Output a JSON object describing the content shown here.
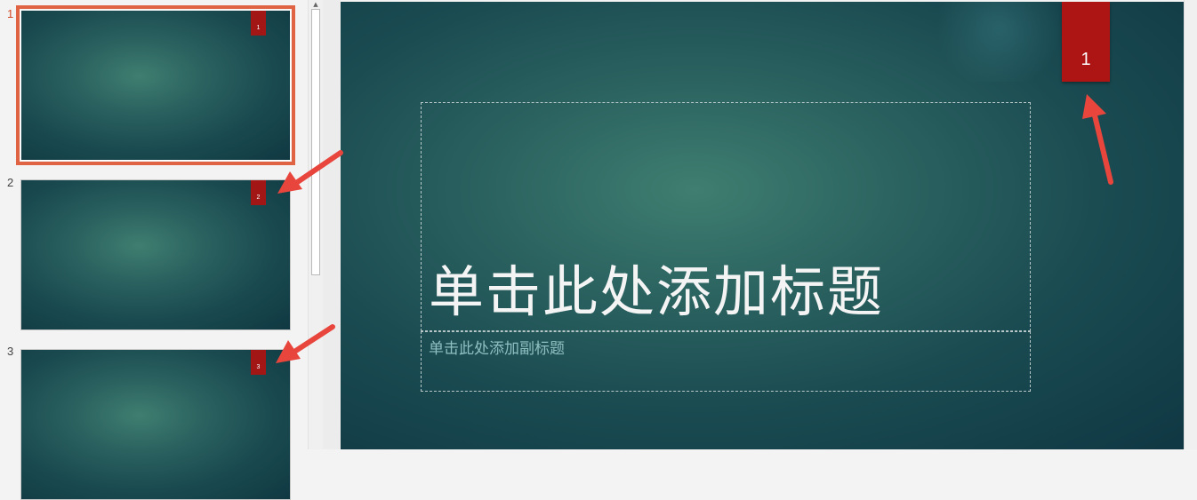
{
  "thumbnails": [
    {
      "number": "1",
      "badge": "1",
      "selected": true
    },
    {
      "number": "2",
      "badge": "2",
      "selected": false
    },
    {
      "number": "3",
      "badge": "3",
      "selected": false
    }
  ],
  "main_slide": {
    "badge": "1",
    "title": "单击此处添加标题",
    "subtitle": "单击此处添加副标题"
  },
  "icons": {
    "scroll_up": "▲"
  },
  "colors": {
    "selection": "#e06343",
    "badge": "#ad1414",
    "annotation_arrow": "#e8463d",
    "slide_dark": "#0f3743",
    "slide_light": "#3f7e70"
  }
}
